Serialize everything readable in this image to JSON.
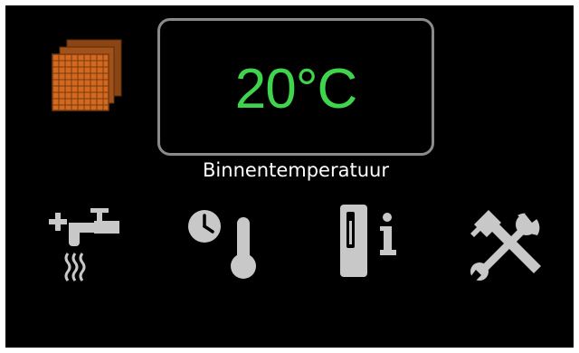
{
  "display": {
    "temperature_value": "20°C",
    "temperature_label": "Binnentemperatuur"
  },
  "icons": {
    "status": "grid-panel-icon",
    "hot_water": "hot-water-tap-icon",
    "schedule_temperature": "clock-thermometer-icon",
    "device_info": "device-info-icon",
    "service_tools": "wrench-hammer-icon"
  },
  "colors": {
    "background": "#000000",
    "temperature_text": "#3fd44c",
    "box_border": "#8a8a8a",
    "icon_gray": "#c8c8c8",
    "grid_orange": "#d2691e"
  }
}
